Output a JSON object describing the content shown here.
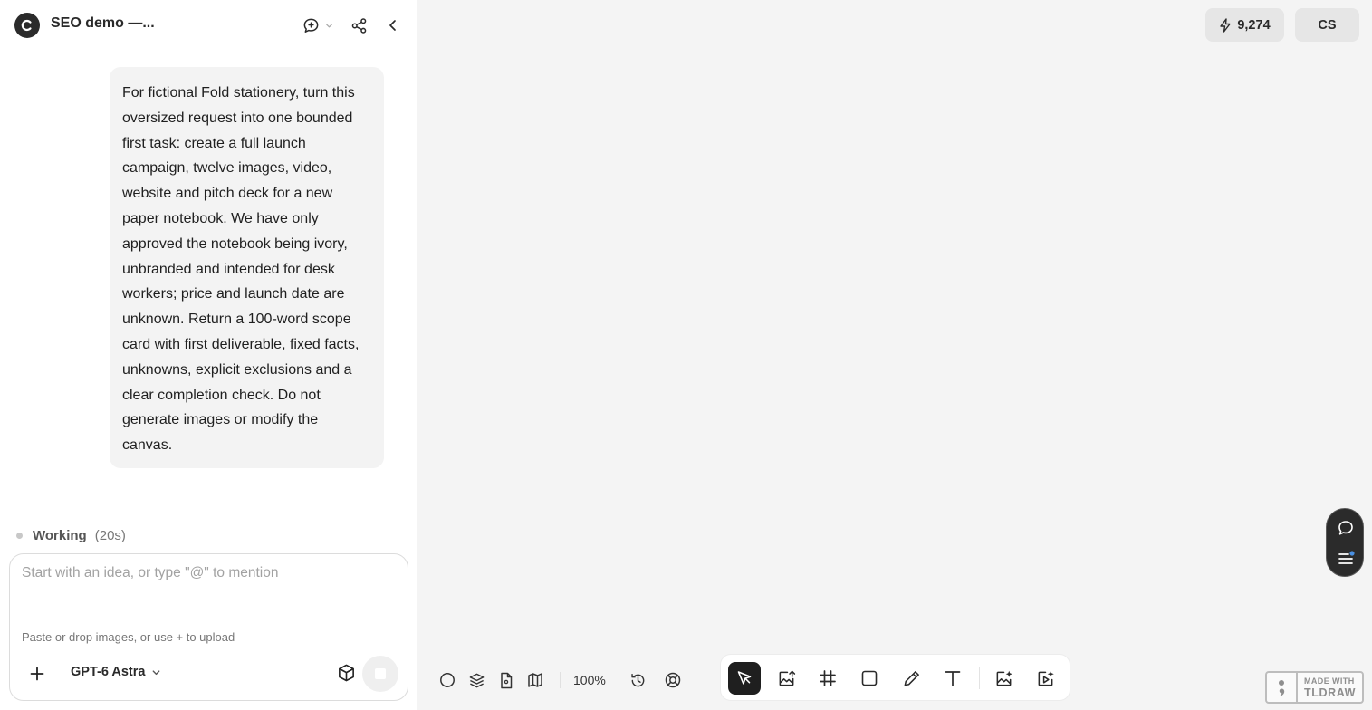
{
  "header": {
    "title": "SEO demo —...",
    "icons": [
      "logo-icon",
      "chat-bubble-icon",
      "chevron-down-icon",
      "share-icon",
      "collapse-chevron-left-icon"
    ]
  },
  "chat": {
    "user_message": "For fictional Fold stationery, turn this oversized request into one bounded first task: create a full launch campaign, twelve images, video, website and pitch deck for a new paper notebook. We have only approved the notebook being ivory, unbranded and intended for desk workers; price and launch date are unknown. Return a 100-word scope card with first deliverable, fixed facts, unknowns, explicit exclusions and a clear completion check. Do not generate images or modify the canvas.",
    "status": {
      "label": "Working",
      "elapsed": "(20s)"
    }
  },
  "composer": {
    "placeholder": "Start with an idea, or type \"@\" to mention",
    "value": "",
    "hint": "Paste or drop images, or use + to upload",
    "model": "GPT-6 Astra"
  },
  "topright": {
    "credits": "9,274",
    "user_initials": "CS"
  },
  "canvas_controls": {
    "zoom": "100%",
    "icons": [
      "circle-icon",
      "layers-icon",
      "page-icon",
      "map-icon",
      "history-icon",
      "help-lifebuoy-icon"
    ]
  },
  "toolbar": {
    "tools": [
      "select-tool",
      "image-upload-tool",
      "frame-tool",
      "rectangle-tool",
      "pencil-tool",
      "text-tool",
      "ai-image-tool",
      "ai-video-tool"
    ],
    "active": "select-tool"
  },
  "watermark": {
    "line1": "MADE WITH",
    "line2": "TLDRAW"
  },
  "colors": {
    "canvas": "#f4f4f4",
    "sidebar": "#ffffff",
    "bubble": "#f3f3f3",
    "active_tool": "#1f1f1f",
    "pill": "#2b2b2b",
    "notify_dot": "#4a90e2"
  }
}
